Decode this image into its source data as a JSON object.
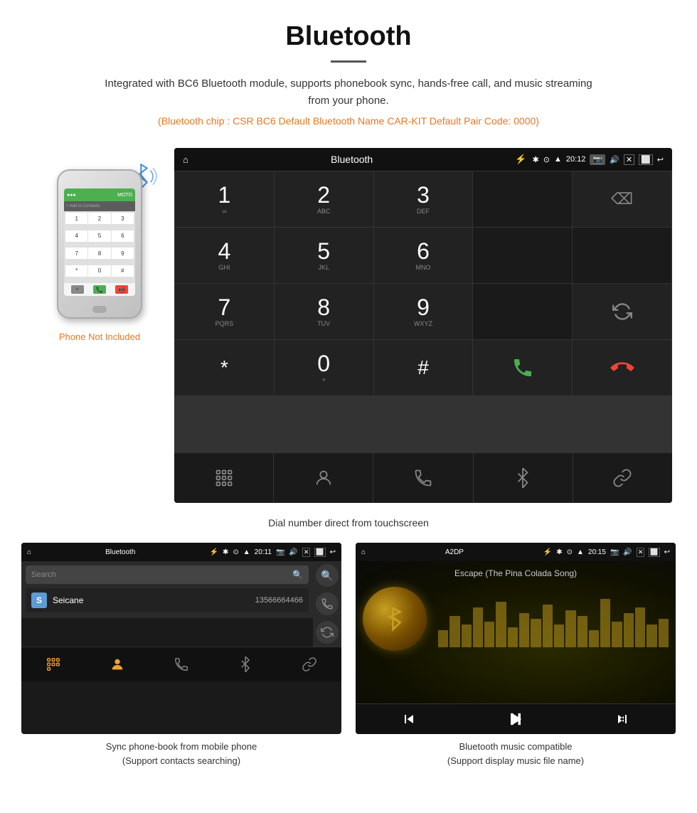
{
  "header": {
    "title": "Bluetooth",
    "description": "Integrated with BC6 Bluetooth module, supports phonebook sync, hands-free call, and music streaming from your phone.",
    "specs": "(Bluetooth chip : CSR BC6    Default Bluetooth Name CAR-KIT    Default Pair Code: 0000)"
  },
  "phone_note": {
    "not_included": "Phone Not Included"
  },
  "dial_screen": {
    "status_bar": {
      "title": "Bluetooth",
      "time": "20:12"
    },
    "caption": "Dial number direct from touchscreen",
    "keys": [
      {
        "num": "1",
        "letters": "∞"
      },
      {
        "num": "2",
        "letters": "ABC"
      },
      {
        "num": "3",
        "letters": "DEF"
      },
      {
        "num": "4",
        "letters": "GHI"
      },
      {
        "num": "5",
        "letters": "JKL"
      },
      {
        "num": "6",
        "letters": "MNO"
      },
      {
        "num": "7",
        "letters": "PQRS"
      },
      {
        "num": "8",
        "letters": "TUV"
      },
      {
        "num": "9",
        "letters": "WXYZ"
      },
      {
        "num": "*",
        "letters": ""
      },
      {
        "num": "0",
        "letters": "+"
      },
      {
        "num": "#",
        "letters": ""
      }
    ]
  },
  "phonebook_screen": {
    "status_bar": {
      "title": "Bluetooth",
      "time": "20:11"
    },
    "search_placeholder": "Search",
    "contact": {
      "letter": "S",
      "name": "Seicane",
      "number": "13566664466"
    },
    "caption_line1": "Sync phone-book from mobile phone",
    "caption_line2": "(Support contacts searching)"
  },
  "music_screen": {
    "status_bar": {
      "title": "A2DP",
      "time": "20:15"
    },
    "song_title": "Escape (The Pina Colada Song)",
    "caption_line1": "Bluetooth music compatible",
    "caption_line2": "(Support display music file name)"
  }
}
